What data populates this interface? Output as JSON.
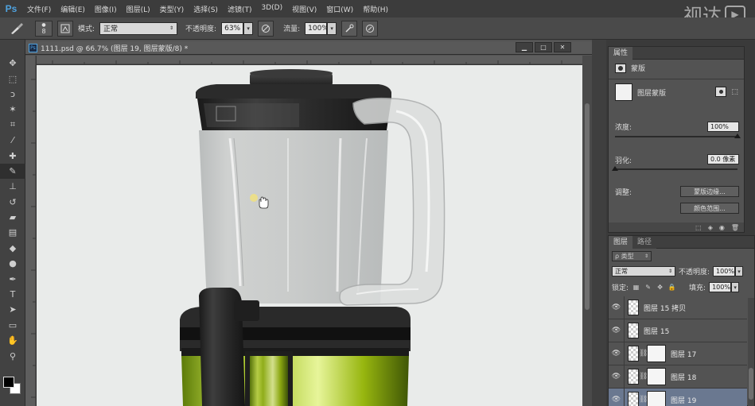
{
  "app": {
    "logo": "Ps",
    "watermark_text": "视达",
    "watermark_icon": "play-icon"
  },
  "menu": [
    {
      "label": "文件(F)"
    },
    {
      "label": "编辑(E)"
    },
    {
      "label": "图像(I)"
    },
    {
      "label": "图层(L)"
    },
    {
      "label": "类型(Y)"
    },
    {
      "label": "选择(S)"
    },
    {
      "label": "滤镜(T)"
    },
    {
      "label": "3D(D)"
    },
    {
      "label": "视图(V)"
    },
    {
      "label": "窗口(W)"
    },
    {
      "label": "帮助(H)"
    }
  ],
  "options_bar": {
    "brush_size": "8",
    "mode_label": "模式:",
    "mode_value": "正常",
    "opacity_label": "不透明度:",
    "opacity_value": "63%",
    "flow_label": "流量:",
    "flow_value": "100%"
  },
  "document": {
    "tab_title": "1111.psd @ 66.7% (图层 19, 图层蒙版/8) *",
    "tab_icon": "Ps"
  },
  "properties_panel": {
    "tab_label": "属性",
    "type_label": "蒙版",
    "mask_label": "图层蒙版",
    "density_label": "浓度:",
    "density_value": "100%",
    "density_level": 1.0,
    "feather_label": "羽化:",
    "feather_value": "0.0 像素",
    "feather_level": 0.0,
    "refine_label": "调整:",
    "mask_edge_button": "蒙版边缘...",
    "color_range_button": "颜色范围..."
  },
  "layers_panel": {
    "tabs": [
      {
        "label": "图层"
      },
      {
        "label": "路径"
      }
    ],
    "filter_placeholder": "ρ 类型",
    "blend_mode": "正常",
    "opacity_label": "不透明度:",
    "opacity_value": "100%",
    "lock_label": "锁定:",
    "fill_label": "填充:",
    "fill_value": "100%",
    "layers": [
      {
        "name": "图层 15 拷贝",
        "has_mask": false,
        "selected": false
      },
      {
        "name": "图层 15",
        "has_mask": false,
        "selected": false
      },
      {
        "name": "图层 17",
        "has_mask": true,
        "selected": false
      },
      {
        "name": "图层 18",
        "has_mask": true,
        "selected": false
      },
      {
        "name": "图层 19",
        "has_mask": true,
        "selected": true
      }
    ]
  },
  "colors": {
    "accent": "#4fa3e0",
    "selected_layer": "#6a7890",
    "canvas_bg": "#e9ebea",
    "base_green": "#9cbd1a"
  }
}
